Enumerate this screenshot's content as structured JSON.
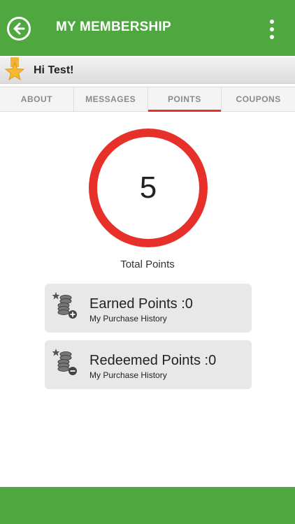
{
  "header": {
    "title": "MY MEMBERSHIP",
    "back_icon": "back-arrow-circle-icon",
    "menu_icon": "vertical-dots-icon",
    "color": "#4ea83f"
  },
  "greeting": {
    "text": "Hi Test!",
    "icon": "star-icon"
  },
  "tabs": [
    {
      "label": "ABOUT",
      "active": false
    },
    {
      "label": "MESSAGES",
      "active": false
    },
    {
      "label": "POINTS",
      "active": true
    },
    {
      "label": "COUPONS",
      "active": false
    }
  ],
  "points": {
    "total": "5",
    "label": "Total Points",
    "ring_color": "#e8302a"
  },
  "cards": {
    "earned": {
      "title": "Earned Points :0",
      "link": "My Purchase History",
      "icon": "coins-plus-icon"
    },
    "redeemed": {
      "title": "Redeemed Points :0",
      "link": "My Purchase History",
      "icon": "coins-minus-icon"
    }
  }
}
